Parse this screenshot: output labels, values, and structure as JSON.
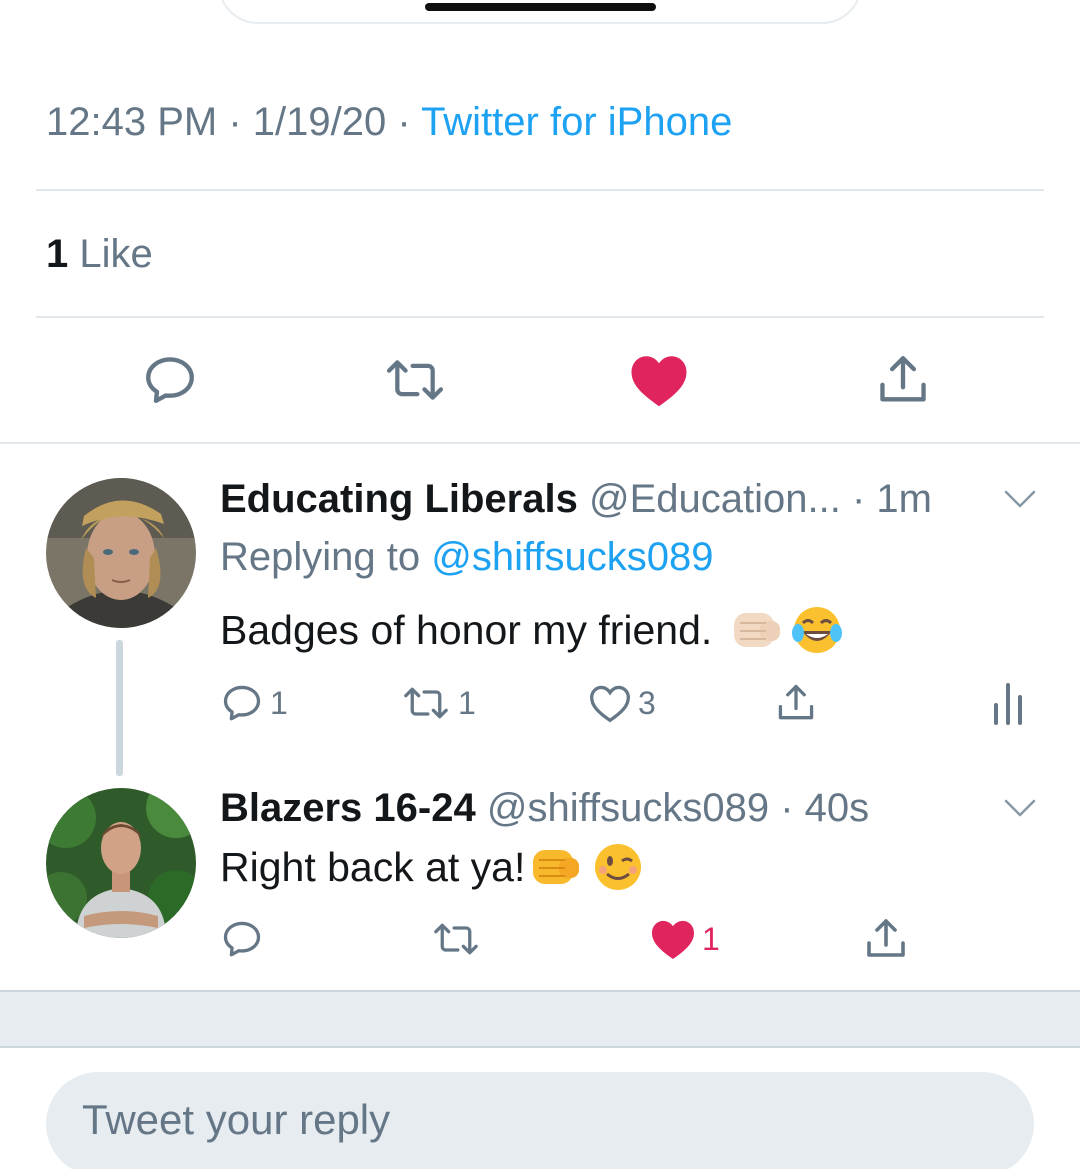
{
  "tweet_meta": {
    "time": "12:43 PM",
    "separator1": " · ",
    "date": "1/19/20",
    "separator2": " · ",
    "source": "Twitter for iPhone"
  },
  "stats": {
    "like_count": "1",
    "like_label": " Like"
  },
  "main_actions": {
    "reply_icon": "reply-icon",
    "retweet_icon": "retweet-icon",
    "like_icon": "heart-filled-icon",
    "share_icon": "share-icon",
    "liked_color": "#e0245e"
  },
  "replies": [
    {
      "display_name": "Educating Liberals",
      "handle": "@Education...",
      "time": "· 1m",
      "replying_prefix": "Replying to ",
      "replying_to": "@shiffsucks089",
      "text": "Badges of honor my friend.",
      "emojis": [
        "fist-bump-emoji",
        "tears-of-joy-emoji"
      ],
      "reply_count": "1",
      "retweet_count": "1",
      "like_count": "3",
      "liked": false
    },
    {
      "display_name": "Blazers 16-24",
      "handle": "@shiffsucks089",
      "time": "· 40s",
      "text": "Right back at ya!",
      "emojis": [
        "fist-bump-emoji",
        "winking-face-emoji"
      ],
      "reply_count": "",
      "retweet_count": "",
      "like_count": "1",
      "liked": true
    }
  ],
  "compose": {
    "placeholder": "Tweet your reply"
  },
  "colors": {
    "accent": "#1da1f2",
    "secondary_text": "#657786",
    "like": "#e0245e",
    "divider": "#e1e8ed"
  }
}
